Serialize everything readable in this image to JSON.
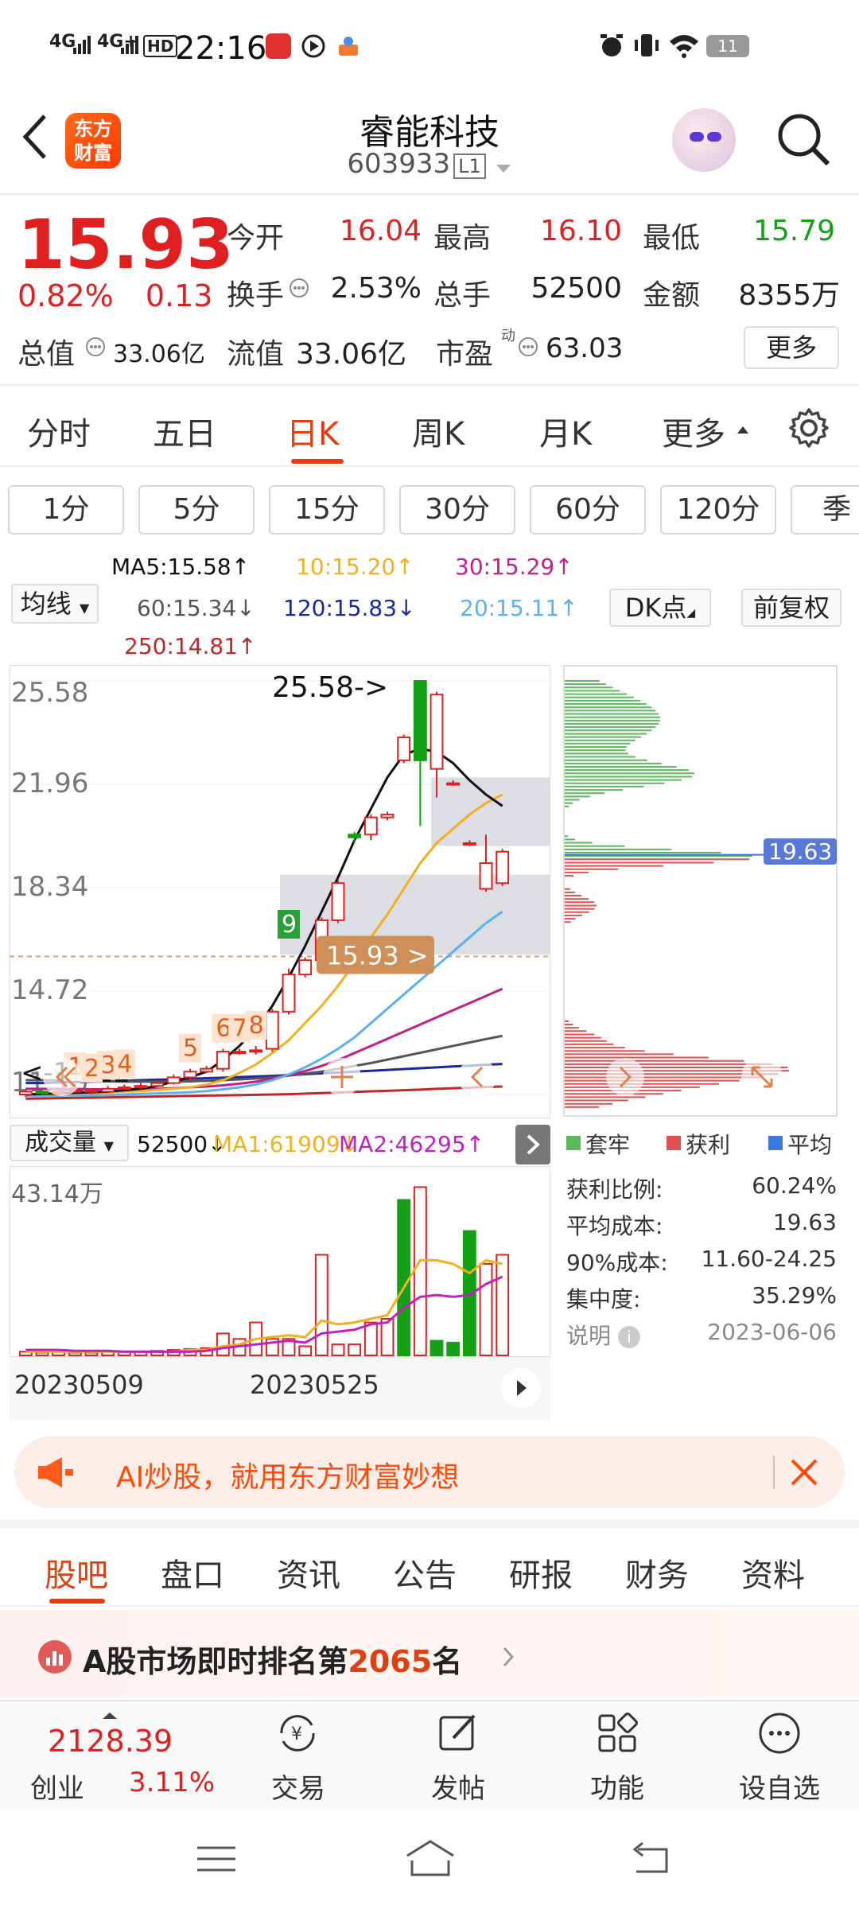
{
  "status_bar": {
    "network": "4G",
    "network2": "4G+",
    "hd": "HD",
    "time": "22:16",
    "battery": "11"
  },
  "header": {
    "back_icon": "back-arrow-icon",
    "logo_text_line1": "东方",
    "logo_text_line2": "财富",
    "stock_name": "睿能科技",
    "stock_code": "603933",
    "level_badge": "L1"
  },
  "quote": {
    "price": "15.93",
    "change_pct": "0.82%",
    "change_abs": "0.13",
    "open_label": "今开",
    "open_value": "16.04",
    "high_label": "最高",
    "high_value": "16.10",
    "low_label": "最低",
    "low_value": "15.79",
    "turnover_label": "换手",
    "turnover_value": "2.53%",
    "volume_label": "总手",
    "volume_value": "52500",
    "amount_label": "金额",
    "amount_value": "8355万",
    "total_cap_label": "总值",
    "total_cap_value": "33.06亿",
    "float_cap_label": "流值",
    "float_cap_value": "33.06亿",
    "pe_label": "市盈",
    "pe_sup": "动",
    "pe_value": "63.03",
    "more_button": "更多"
  },
  "chart_tabs": [
    "分时",
    "五日",
    "日K",
    "周K",
    "月K",
    "更多"
  ],
  "active_chart_tab": "日K",
  "periods": [
    "1分",
    "5分",
    "15分",
    "30分",
    "60分",
    "120分",
    "季"
  ],
  "indicator_select": "均线",
  "ma_legend": {
    "ma5": "MA5:15.58↑",
    "ma10": "10:15.20↑",
    "ma30": "30:15.29↑",
    "ma60": "60:15.34↓",
    "ma120": "120:15.83↓",
    "ma20": "20:15.11↑",
    "ma250": "250:14.81↑"
  },
  "dk_button": "DK点",
  "adjust_button": "前复权",
  "colors": {
    "up": "#e02020",
    "down": "#14a014",
    "accent": "#e0400f",
    "ma5": "#111111",
    "ma10": "#f0b020",
    "ma20": "#5ab0f0",
    "ma30": "#c0208a",
    "ma60": "#555555",
    "ma120": "#1a2a9a",
    "ma250": "#c02828"
  },
  "chart_data": {
    "type": "candlestick",
    "y_ticks": [
      "25.58",
      "21.96",
      "18.34",
      "14.72",
      "11.10"
    ],
    "ylim": [
      11.1,
      25.58
    ],
    "high_marker": "25.58->",
    "low_marker": "<-11.12",
    "price_label": "15.93 >",
    "nine_turn_labels": [
      "1",
      "2",
      "3",
      "4",
      "5",
      "6",
      "7",
      "8",
      "9"
    ],
    "candles": [
      {
        "o": 11.1,
        "c": 11.2,
        "h": 11.3,
        "l": 11.0
      },
      {
        "o": 11.2,
        "c": 11.15,
        "h": 11.3,
        "l": 11.1
      },
      {
        "o": 11.15,
        "c": 11.2,
        "h": 11.3,
        "l": 11.1
      },
      {
        "o": 11.2,
        "c": 11.25,
        "h": 11.35,
        "l": 11.15
      },
      {
        "o": 11.2,
        "c": 11.25,
        "h": 11.3,
        "l": 11.1
      },
      {
        "o": 11.2,
        "c": 11.3,
        "h": 11.4,
        "l": 11.15
      },
      {
        "o": 11.3,
        "c": 11.35,
        "h": 11.45,
        "l": 11.25
      },
      {
        "o": 11.35,
        "c": 11.4,
        "h": 11.5,
        "l": 11.3
      },
      {
        "o": 11.4,
        "c": 11.5,
        "h": 11.6,
        "l": 11.35
      },
      {
        "o": 11.5,
        "c": 11.7,
        "h": 11.8,
        "l": 11.45
      },
      {
        "o": 11.7,
        "c": 11.9,
        "h": 12.0,
        "l": 11.6
      },
      {
        "o": 11.9,
        "c": 12.0,
        "h": 12.1,
        "l": 11.85
      },
      {
        "o": 12.0,
        "c": 12.6,
        "h": 12.7,
        "l": 11.9
      },
      {
        "o": 12.6,
        "c": 12.6,
        "h": 12.7,
        "l": 12.5
      },
      {
        "o": 12.6,
        "c": 12.65,
        "h": 12.8,
        "l": 12.5
      },
      {
        "o": 12.7,
        "c": 14.0,
        "h": 14.1,
        "l": 12.6
      },
      {
        "o": 14.0,
        "c": 15.3,
        "h": 15.5,
        "l": 13.9
      },
      {
        "o": 15.3,
        "c": 15.8,
        "h": 15.9,
        "l": 15.2
      },
      {
        "o": 15.8,
        "c": 17.2,
        "h": 17.3,
        "l": 15.7
      },
      {
        "o": 17.2,
        "c": 18.5,
        "h": 18.6,
        "l": 17.1
      },
      {
        "o": 20.2,
        "c": 20.1,
        "h": 20.3,
        "l": 19.9
      },
      {
        "o": 20.2,
        "c": 20.8,
        "h": 20.9,
        "l": 20.0
      },
      {
        "o": 20.8,
        "c": 20.9,
        "h": 21.0,
        "l": 20.7
      },
      {
        "o": 22.8,
        "c": 23.6,
        "h": 23.7,
        "l": 22.7
      },
      {
        "o": 25.58,
        "c": 22.8,
        "h": 25.58,
        "l": 20.5
      },
      {
        "o": 22.5,
        "c": 25.1,
        "h": 25.2,
        "l": 21.5
      },
      {
        "o": 22.0,
        "c": 22.0,
        "h": 22.1,
        "l": 21.9
      },
      {
        "o": 19.9,
        "c": 19.9,
        "h": 20.0,
        "l": 19.8
      },
      {
        "o": 18.3,
        "c": 19.2,
        "h": 20.2,
        "l": 18.2
      },
      {
        "o": 18.5,
        "c": 19.6,
        "h": 19.7,
        "l": 18.4
      }
    ],
    "ma5": [
      11.1,
      11.12,
      11.14,
      11.16,
      11.18,
      11.2,
      11.25,
      11.3,
      11.4,
      11.55,
      11.7,
      11.9,
      12.3,
      12.8,
      13.4,
      14.2,
      15.2,
      16.3,
      17.5,
      18.7,
      20.0,
      21.1,
      22.2,
      23.0,
      23.2,
      23.1,
      22.7,
      22.1,
      21.6,
      21.2
    ],
    "ma10": [
      11.1,
      11.1,
      11.12,
      11.13,
      11.15,
      11.17,
      11.2,
      11.22,
      11.26,
      11.3,
      11.35,
      11.45,
      11.6,
      11.85,
      12.15,
      12.55,
      13.0,
      13.6,
      14.2,
      14.9,
      15.7,
      16.6,
      17.4,
      18.3,
      19.2,
      19.9,
      20.4,
      20.9,
      21.3,
      21.6
    ],
    "ma20": [
      11.05,
      11.05,
      11.06,
      11.07,
      11.07,
      11.08,
      11.1,
      11.12,
      11.14,
      11.16,
      11.18,
      11.22,
      11.28,
      11.35,
      11.45,
      11.6,
      11.8,
      12.05,
      12.35,
      12.7,
      13.1,
      13.6,
      14.1,
      14.6,
      15.1,
      15.6,
      16.1,
      16.6,
      17.1,
      17.5
    ],
    "ma30": [
      11.3,
      11.3,
      11.3,
      11.3,
      11.28,
      11.28,
      11.28,
      11.3,
      11.3,
      11.32,
      11.35,
      11.38,
      11.42,
      11.48,
      11.55,
      11.65,
      11.78,
      11.92,
      12.1,
      12.3,
      12.55,
      12.8,
      13.05,
      13.3,
      13.55,
      13.8,
      14.05,
      14.3,
      14.55,
      14.8
    ],
    "ma60": [
      11.6,
      11.6,
      11.6,
      11.58,
      11.58,
      11.56,
      11.55,
      11.55,
      11.55,
      11.55,
      11.56,
      11.58,
      11.6,
      11.63,
      11.66,
      11.7,
      11.76,
      11.83,
      11.9,
      12.0,
      12.1,
      12.2,
      12.32,
      12.44,
      12.56,
      12.68,
      12.8,
      12.92,
      13.04,
      13.15
    ],
    "ma120": [
      11.5,
      11.5,
      11.52,
      11.53,
      11.55,
      11.56,
      11.58,
      11.6,
      11.62,
      11.63,
      11.65,
      11.67,
      11.69,
      11.71,
      11.73,
      11.75,
      11.78,
      11.81,
      11.84,
      11.87,
      11.9,
      11.93,
      11.96,
      11.99,
      12.02,
      12.05,
      12.08,
      12.11,
      12.14,
      12.17
    ],
    "ma250": [
      10.95,
      10.96,
      10.97,
      10.98,
      10.99,
      11.0,
      11.01,
      11.02,
      11.03,
      11.04,
      11.05,
      11.06,
      11.07,
      11.08,
      11.09,
      11.1,
      11.11,
      11.13,
      11.15,
      11.17,
      11.19,
      11.21,
      11.23,
      11.25,
      11.27,
      11.3,
      11.32,
      11.34,
      11.36,
      11.38
    ]
  },
  "volume": {
    "indicator_select": "成交量",
    "current": "52500↓",
    "ma1": "MA1:61909↓",
    "ma2": "MA2:46295↑",
    "max_label": "43.14万",
    "dates": [
      "20230509",
      "20230525"
    ],
    "bars": [
      0.02,
      0.015,
      0.02,
      0.015,
      0.015,
      0.02,
      0.02,
      0.02,
      0.025,
      0.03,
      0.035,
      0.04,
      0.12,
      0.09,
      0.18,
      0.09,
      0.09,
      0.05,
      0.55,
      0.06,
      0.06,
      0.18,
      0.2,
      0.85,
      0.92,
      0.08,
      0.07,
      0.68,
      0.5,
      0.55
    ],
    "bar_up": [
      true,
      true,
      true,
      true,
      true,
      true,
      true,
      true,
      true,
      true,
      true,
      true,
      true,
      true,
      true,
      true,
      true,
      true,
      true,
      true,
      true,
      true,
      true,
      false,
      true,
      false,
      false,
      false,
      true,
      true
    ],
    "ma1_line": [
      0.02,
      0.02,
      0.02,
      0.02,
      0.02,
      0.02,
      0.02,
      0.02,
      0.02,
      0.02,
      0.03,
      0.03,
      0.05,
      0.06,
      0.09,
      0.1,
      0.11,
      0.1,
      0.19,
      0.17,
      0.18,
      0.2,
      0.22,
      0.37,
      0.52,
      0.52,
      0.5,
      0.45,
      0.52,
      0.5
    ],
    "ma2_line": [
      0.03,
      0.03,
      0.03,
      0.025,
      0.025,
      0.025,
      0.02,
      0.02,
      0.02,
      0.02,
      0.02,
      0.025,
      0.04,
      0.05,
      0.06,
      0.07,
      0.08,
      0.07,
      0.12,
      0.13,
      0.14,
      0.17,
      0.18,
      0.26,
      0.32,
      0.33,
      0.32,
      0.33,
      0.39,
      0.43
    ]
  },
  "chip_distribution": {
    "avg_cost_tag": "19.63",
    "legend": [
      "套牢",
      "获利",
      "平均"
    ],
    "profit_ratio_label": "获利比例:",
    "profit_ratio": "60.24%",
    "avg_cost_label": "平均成本:",
    "avg_cost": "19.63",
    "cost90_label": "90%成本:",
    "cost90": "11.60-24.25",
    "concentration_label": "集中度:",
    "concentration": "35.29%",
    "note_label": "说明",
    "date": "2023-06-06"
  },
  "banner": {
    "text": "AI炒股，就用东方财富妙想"
  },
  "sub_tabs": [
    "股吧",
    "盘口",
    "资讯",
    "公告",
    "研报",
    "财务",
    "资料"
  ],
  "active_sub_tab": "股吧",
  "rank": {
    "prefix": "A股市场即时排名第",
    "number": "2065",
    "suffix": "名"
  },
  "bottom_nav": {
    "index_value": "2128.39",
    "index_name": "创业",
    "index_change": "3.11%",
    "items": [
      "交易",
      "发帖",
      "功能",
      "设自选"
    ]
  }
}
